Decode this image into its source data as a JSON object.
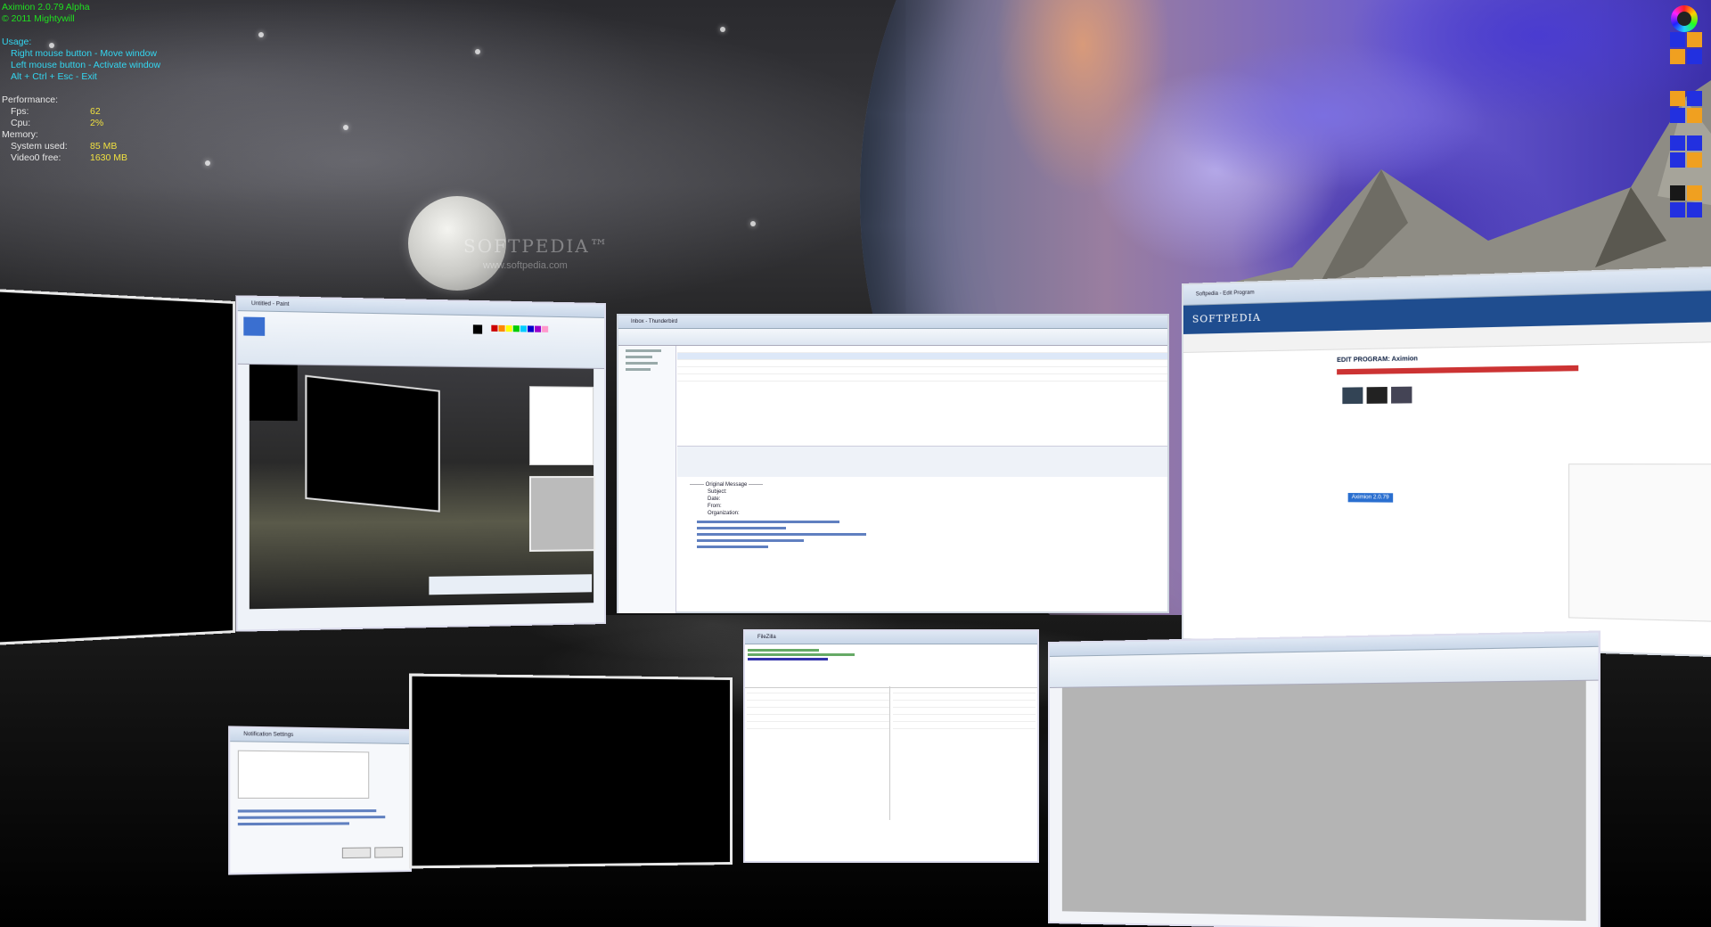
{
  "hud": {
    "app_title": "Aximion 2.0.79 Alpha",
    "copyright": "© 2011 Mightywill",
    "usage_header": "Usage:",
    "usage_lines": [
      "Right mouse button  - Move window",
      "Left mouse button  - Activate window",
      "Alt + Ctrl + Esc  - Exit"
    ],
    "performance_header": "Performance:",
    "fps_label": "Fps:",
    "fps_value": "62",
    "cpu_label": "Cpu:",
    "cpu_value": "2%",
    "memory_header": "Memory:",
    "system_used_label": "System used:",
    "system_used_value": "85 MB",
    "video_free_label": "Video0 free:",
    "video_free_value": "1630 MB"
  },
  "watermark": {
    "brand": "SOFTPEDIA™",
    "url": "www.softpedia.com"
  },
  "workspace_icons": [
    {
      "name": "workspace-1",
      "quads": [
        "blue",
        "orange",
        "orange",
        "blue"
      ]
    },
    {
      "name": "workspace-2",
      "quads": [
        "orange",
        "blue",
        "blue",
        "orange"
      ]
    },
    {
      "name": "workspace-3",
      "quads": [
        "blue",
        "blue",
        "blue",
        "orange"
      ]
    },
    {
      "name": "workspace-4",
      "quads": [
        "dark",
        "orange",
        "blue",
        "blue"
      ]
    }
  ],
  "windows": {
    "paint": {
      "title": "Untitled - Paint"
    },
    "mail": {
      "title": "Inbox - Thunderbird",
      "body_lines": [
        "-------- Original Message --------",
        "Subject:",
        "Date:",
        "From:",
        "Organization:"
      ]
    },
    "browser": {
      "title": "Softpedia - Edit Program",
      "brand": "SOFTPEDIA",
      "heading": "EDIT PROGRAM: Aximion",
      "badge": "Aximion 2.0.79"
    },
    "ftp": {
      "title": "FileZilla"
    },
    "notify": {
      "title": "Notification Settings"
    },
    "blank": {
      "title": ""
    }
  },
  "colors": {
    "hud_green": "#1fe01f",
    "hud_cyan": "#33d6f0",
    "hud_yellow": "#f0e040",
    "workspace_blue": "#2230e0",
    "workspace_orange": "#f0a020"
  }
}
